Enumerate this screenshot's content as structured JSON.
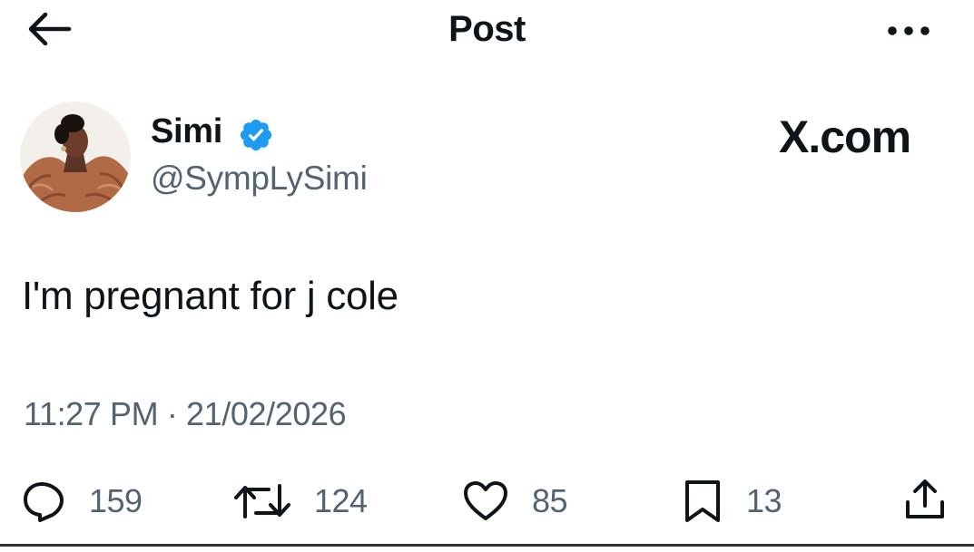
{
  "header": {
    "back_icon": "arrow-left-icon",
    "title": "Post",
    "more_icon": "more-dots-icon"
  },
  "author": {
    "name": "Simi",
    "handle": "@SympLySimi",
    "verified_icon": "verified-badge-icon",
    "verified_color": "#1d9bf0"
  },
  "watermark": "X.com",
  "post": {
    "text": "I'm pregnant for j cole",
    "timestamp": "11:27 PM · 21/02/2026"
  },
  "actions": {
    "reply": {
      "icon": "reply-icon",
      "count": "159"
    },
    "repost": {
      "icon": "repost-icon",
      "count": "124"
    },
    "like": {
      "icon": "heart-icon",
      "count": "85"
    },
    "bookmark": {
      "icon": "bookmark-icon",
      "count": "13"
    },
    "share": {
      "icon": "share-icon"
    }
  },
  "colors": {
    "text": "#0f1419",
    "secondary": "#536471",
    "accent": "#1d9bf0"
  }
}
